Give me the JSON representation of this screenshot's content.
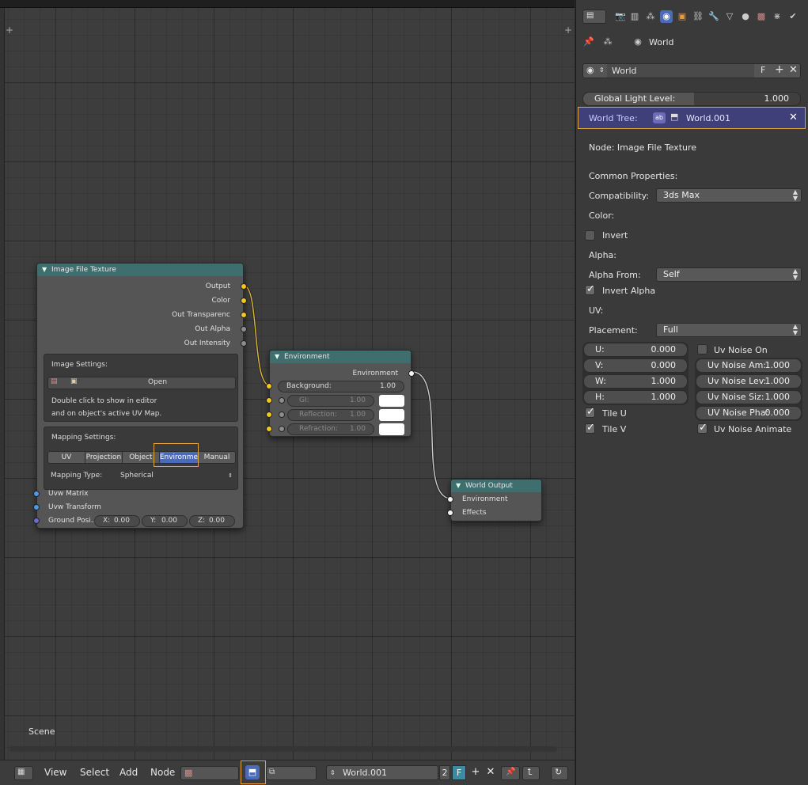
{
  "node_editor": {
    "scene_label": "Scene",
    "image_node": {
      "title": "Image File Texture",
      "outputs": [
        "Output",
        "Color",
        "Out Transparenc",
        "Out Alpha",
        "Out Intensity"
      ],
      "image_settings_label": "Image Settings:",
      "open_label": "Open",
      "hint_line1": "Double click to show in editor",
      "hint_line2": "and on object's active UV Map.",
      "mapping_settings_label": "Mapping Settings:",
      "mapping_tabs": [
        "UV",
        "Projection",
        "Object",
        "Environme",
        "Manual"
      ],
      "mapping_active": "Environme",
      "mapping_type_label": "Mapping Type:",
      "mapping_type_value": "Spherical",
      "inputs": [
        "Uvw Matrix",
        "Uvw Transform"
      ],
      "ground_label": "Ground Posi...",
      "ground_x_label": "X:",
      "ground_x": "0.00",
      "ground_y_label": "Y:",
      "ground_y": "0.00",
      "ground_z_label": "Z:",
      "ground_z": "0.00"
    },
    "env_node": {
      "title": "Environment",
      "output": "Environment",
      "background_label": "Background:",
      "background_value": "1.00",
      "gi_label": "GI:",
      "gi_value": "1.00",
      "reflection_label": "Reflection:",
      "reflection_value": "1.00",
      "refraction_label": "Refraction:",
      "refraction_value": "1.00"
    },
    "output_node": {
      "title": "World Output",
      "inputs": [
        "Environment",
        "Effects"
      ]
    }
  },
  "bottom_bar": {
    "menus": [
      "View",
      "Select",
      "Add",
      "Node"
    ],
    "world_name": "World.001",
    "users": "2",
    "fake_user": "F"
  },
  "properties": {
    "breadcrumb": "World",
    "world_field": "World",
    "fake_user": "F",
    "global_light_label": "Global Light Level:",
    "global_light_value": "1.000",
    "world_tree_label": "World Tree:",
    "world_tree_value": "World.001",
    "node_label": "Node: Image File Texture",
    "common_props": "Common Properties:",
    "compat_label": "Compatibility:",
    "compat_value": "3ds Max",
    "color_label": "Color:",
    "invert_label": "Invert",
    "invert": false,
    "alpha_label": "Alpha:",
    "alpha_from_label": "Alpha From:",
    "alpha_from_value": "Self",
    "invert_alpha_label": "Invert Alpha",
    "invert_alpha": true,
    "uv_label": "UV:",
    "placement_label": "Placement:",
    "placement_value": "Full",
    "u_label": "U:",
    "u_value": "0.000",
    "v_label": "V:",
    "v_value": "0.000",
    "w_label": "W:",
    "w_value": "1.000",
    "h_label": "H:",
    "h_value": "1.000",
    "tile_u_label": "Tile U",
    "tile_u": true,
    "tile_v_label": "Tile V",
    "tile_v": true,
    "uv_noise_on_label": "Uv Noise On",
    "uv_noise_on": false,
    "noise_am_label": "Uv Noise Am:",
    "noise_am_value": "1.000",
    "noise_lev_label": "Uv Noise Lev:",
    "noise_lev_value": "1.000",
    "noise_siz_label": "Uv Noise Siz:",
    "noise_siz_value": "1.000",
    "noise_pha_label": "UV Noise Pha:",
    "noise_pha_value": "0.000",
    "noise_animate_label": "Uv Noise Animate",
    "noise_animate": true
  },
  "colors": {
    "node_header": "#3f6e6e",
    "socket_yellow": "#f5c71a",
    "socket_blue": "#4b9be8",
    "highlight": "#e8a33a",
    "active_blue": "#4b6bb8"
  }
}
